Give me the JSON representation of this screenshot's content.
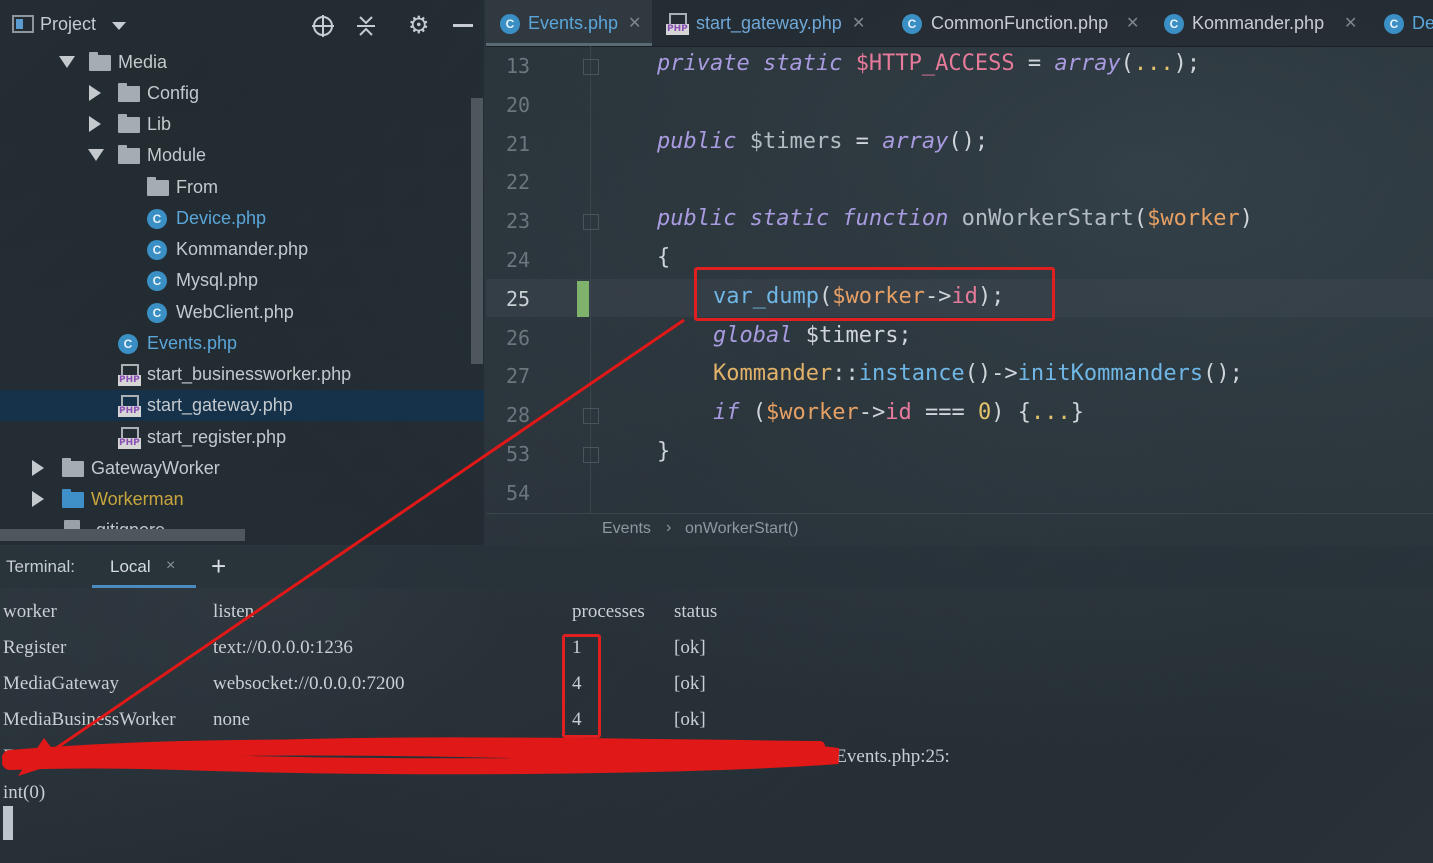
{
  "project": {
    "title": "Project",
    "tree": [
      {
        "label": "Media",
        "type": "folder",
        "expanded": true
      },
      {
        "label": "Config",
        "type": "folder",
        "expanded": false
      },
      {
        "label": "Lib",
        "type": "folder",
        "expanded": false
      },
      {
        "label": "Module",
        "type": "folder",
        "expanded": true
      },
      {
        "label": "From",
        "type": "folder"
      },
      {
        "label": "Device.php",
        "type": "class"
      },
      {
        "label": "Kommander.php",
        "type": "class"
      },
      {
        "label": "Mysql.php",
        "type": "class"
      },
      {
        "label": "WebClient.php",
        "type": "class"
      },
      {
        "label": "Events.php",
        "type": "class"
      },
      {
        "label": "start_businessworker.php",
        "type": "php"
      },
      {
        "label": "start_gateway.php",
        "type": "php",
        "selected": true
      },
      {
        "label": "start_register.php",
        "type": "php"
      },
      {
        "label": "GatewayWorker",
        "type": "folder",
        "expanded": false
      },
      {
        "label": "Workerman",
        "type": "folder",
        "expanded": false
      },
      {
        "label": ".gitignore",
        "type": "file"
      }
    ]
  },
  "tabs": [
    {
      "label": "Events.php",
      "icon": "class-icon",
      "active": true
    },
    {
      "label": "start_gateway.php",
      "icon": "php-file-icon"
    },
    {
      "label": "CommonFunction.php",
      "icon": "class-icon"
    },
    {
      "label": "Kommander.php",
      "icon": "class-icon"
    },
    {
      "label": "De",
      "icon": "class-icon"
    }
  ],
  "editor": {
    "line_numbers": [
      "13",
      "20",
      "21",
      "22",
      "23",
      "24",
      "25",
      "26",
      "27",
      "28",
      "53",
      "54"
    ],
    "current_line": "25"
  },
  "breadcrumb": {
    "class_name": "Events",
    "separator": "›",
    "method_name": "onWorkerStart()"
  },
  "terminal": {
    "title": "Terminal:",
    "tab_label": "Local",
    "tab_close": "×",
    "add_label": "+",
    "header": {
      "worker": "worker",
      "listen": "listen",
      "processes": "processes",
      "status": "status"
    },
    "rows": [
      {
        "worker": "Register",
        "listen": "text://0.0.0.0:1236",
        "processes": "1",
        "status": "[ok]"
      },
      {
        "worker": "MediaGateway",
        "listen": "websocket://0.0.0.0:7200",
        "processes": "4",
        "status": "[ok]"
      },
      {
        "worker": "MediaBusinessWorker",
        "listen": "none",
        "processes": "4",
        "status": "[ok]"
      }
    ],
    "path_line_start": "E:\\",
    "path_line_end": "\\Events.php:25:",
    "output": "int(0)"
  },
  "colors": {
    "highlight_red": "#e02020",
    "selection": "#16314a",
    "accent": "#4a8bc0"
  }
}
